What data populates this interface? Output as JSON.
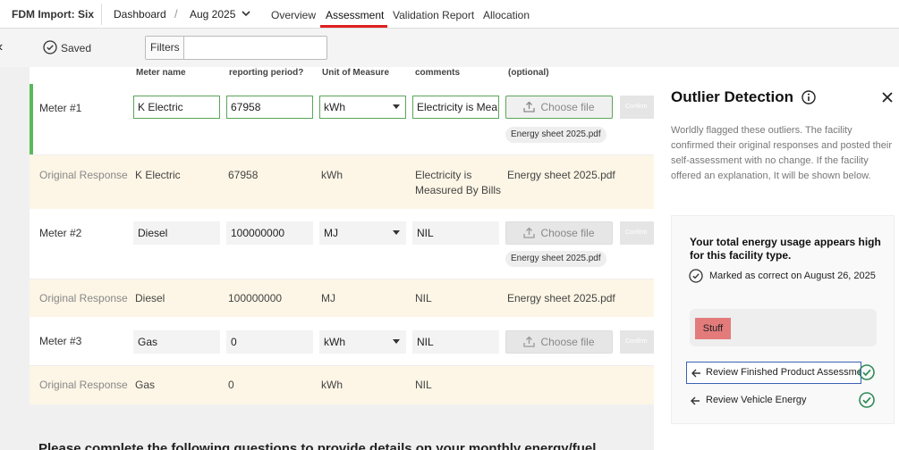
{
  "app": {
    "title": "FDM Import: Six"
  },
  "nav": {
    "dashboard": "Dashboard",
    "period": "Aug 2025",
    "tabs": [
      "Overview",
      "Assessment",
      "Validation Report",
      "Allocation"
    ]
  },
  "toolbar": {
    "saved_label": "Saved",
    "filters_label": "Filters",
    "filters_value": ""
  },
  "table": {
    "headers": [
      "Meter name",
      "reporting period?",
      "Unit of Measure",
      "comments",
      "(optional)"
    ],
    "rows": [
      {
        "label": "Meter #1",
        "name": "K Electric",
        "value": "67958",
        "unit": "kWh",
        "comment": "Electricity is Mea",
        "file": "Energy sheet 2025.pdf",
        "choose": "Choose file",
        "confirm": "Confirm"
      },
      {
        "label": "Original Response",
        "name": "K Electric",
        "value": "67958",
        "unit": "kWh",
        "comment_line1": "Electricity is",
        "comment_line2": "Measured By Bills",
        "file": "Energy sheet 2025.pdf"
      },
      {
        "label": "Meter #2",
        "name": "Diesel",
        "value": "100000000",
        "unit": "MJ",
        "comment": "NIL",
        "file": "Energy sheet 2025.pdf",
        "choose": "Choose file",
        "confirm": "Confirm"
      },
      {
        "label": "Original Response",
        "name": "Diesel",
        "value": "100000000",
        "unit": "MJ",
        "comment": "NIL",
        "file": "Energy sheet 2025.pdf"
      },
      {
        "label": "Meter #3",
        "name": "Gas",
        "value": "0",
        "unit": "kWh",
        "comment": "NIL",
        "choose": "Choose file",
        "confirm": "Confirm"
      },
      {
        "label": "Original Response",
        "name": "Gas",
        "value": "0",
        "unit": "kWh",
        "comment": "NIL"
      }
    ],
    "bottom_text": "Please complete the following questions to provide details on your monthly energy/fuel"
  },
  "panel": {
    "title": "Outlier Detection",
    "description": "Worldly flagged these outliers. The facility confirmed their original responses and posted their self-assessment with no change. If the facility offered an explanation, It will be shown below.",
    "card": {
      "title": "Your total energy usage appears high for this facility type.",
      "marked": "Marked as correct on August 26, 2025",
      "tag": "Stuff"
    },
    "reviews": [
      "Review Finished Product Assessment",
      "Review Vehicle Energy"
    ]
  },
  "colors": {
    "accent": "#e02020",
    "green": "#5bb85b",
    "highlight": "#fdf6e6",
    "tag": "#e37b7b",
    "focus": "#3a62b5"
  }
}
